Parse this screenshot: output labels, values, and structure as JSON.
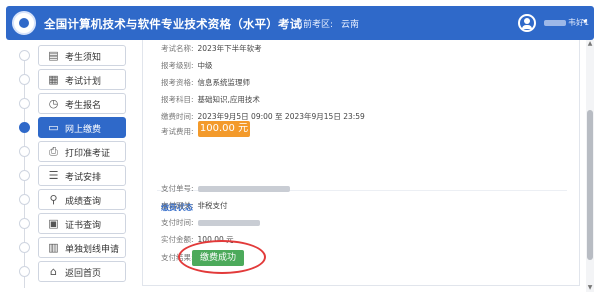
{
  "header": {
    "title": "全国计算机技术与软件专业技术资格（水平）考试",
    "region_label": "当前考区:",
    "region_value": "云南",
    "username": "韦好1"
  },
  "sidebar": {
    "items": [
      {
        "label": "考生须知",
        "icon": "document-icon"
      },
      {
        "label": "考试计划",
        "icon": "calendar-icon"
      },
      {
        "label": "考生报名",
        "icon": "clock-icon"
      },
      {
        "label": "网上缴费",
        "icon": "monitor-payment-icon",
        "active": true
      },
      {
        "label": "打印准考证",
        "icon": "printer-icon"
      },
      {
        "label": "考试安排",
        "icon": "checklist-icon"
      },
      {
        "label": "成绩查询",
        "icon": "search-icon"
      },
      {
        "label": "证书查询",
        "icon": "certificate-icon"
      },
      {
        "label": "单独划线申请",
        "icon": "form-icon"
      },
      {
        "label": "返回首页",
        "icon": "home-icon"
      }
    ]
  },
  "exam_info": {
    "exam_name_label": "考试名称:",
    "exam_name": "2023年下半年软考",
    "level_label": "报考级别:",
    "level": "中级",
    "qualification_label": "报考资格:",
    "qualification": "信息系统监理师",
    "subject_label": "报考科目:",
    "subject": "基础知识,应用技术",
    "payment_time_label": "缴费时间:",
    "payment_time": "2023年9月5日 09:00 至 2023年9月15日 23:59",
    "fee_label": "考试费用:",
    "fee": "100.00 元"
  },
  "payment_status": {
    "section_title": "缴费状态",
    "order_no_label": "支付单号:",
    "gateway_label": "支付网关:",
    "gateway": "非税支付",
    "pay_time_label": "支付时间:",
    "amount_label": "实付金额:",
    "amount": "100.00 元",
    "result_label": "支付结果:",
    "result": "缴费成功"
  },
  "colors": {
    "header_blue": "#2f69c9",
    "fee_orange": "#f39a2b",
    "success_green": "#4caa5b",
    "highlight_red": "#e23a3a"
  }
}
